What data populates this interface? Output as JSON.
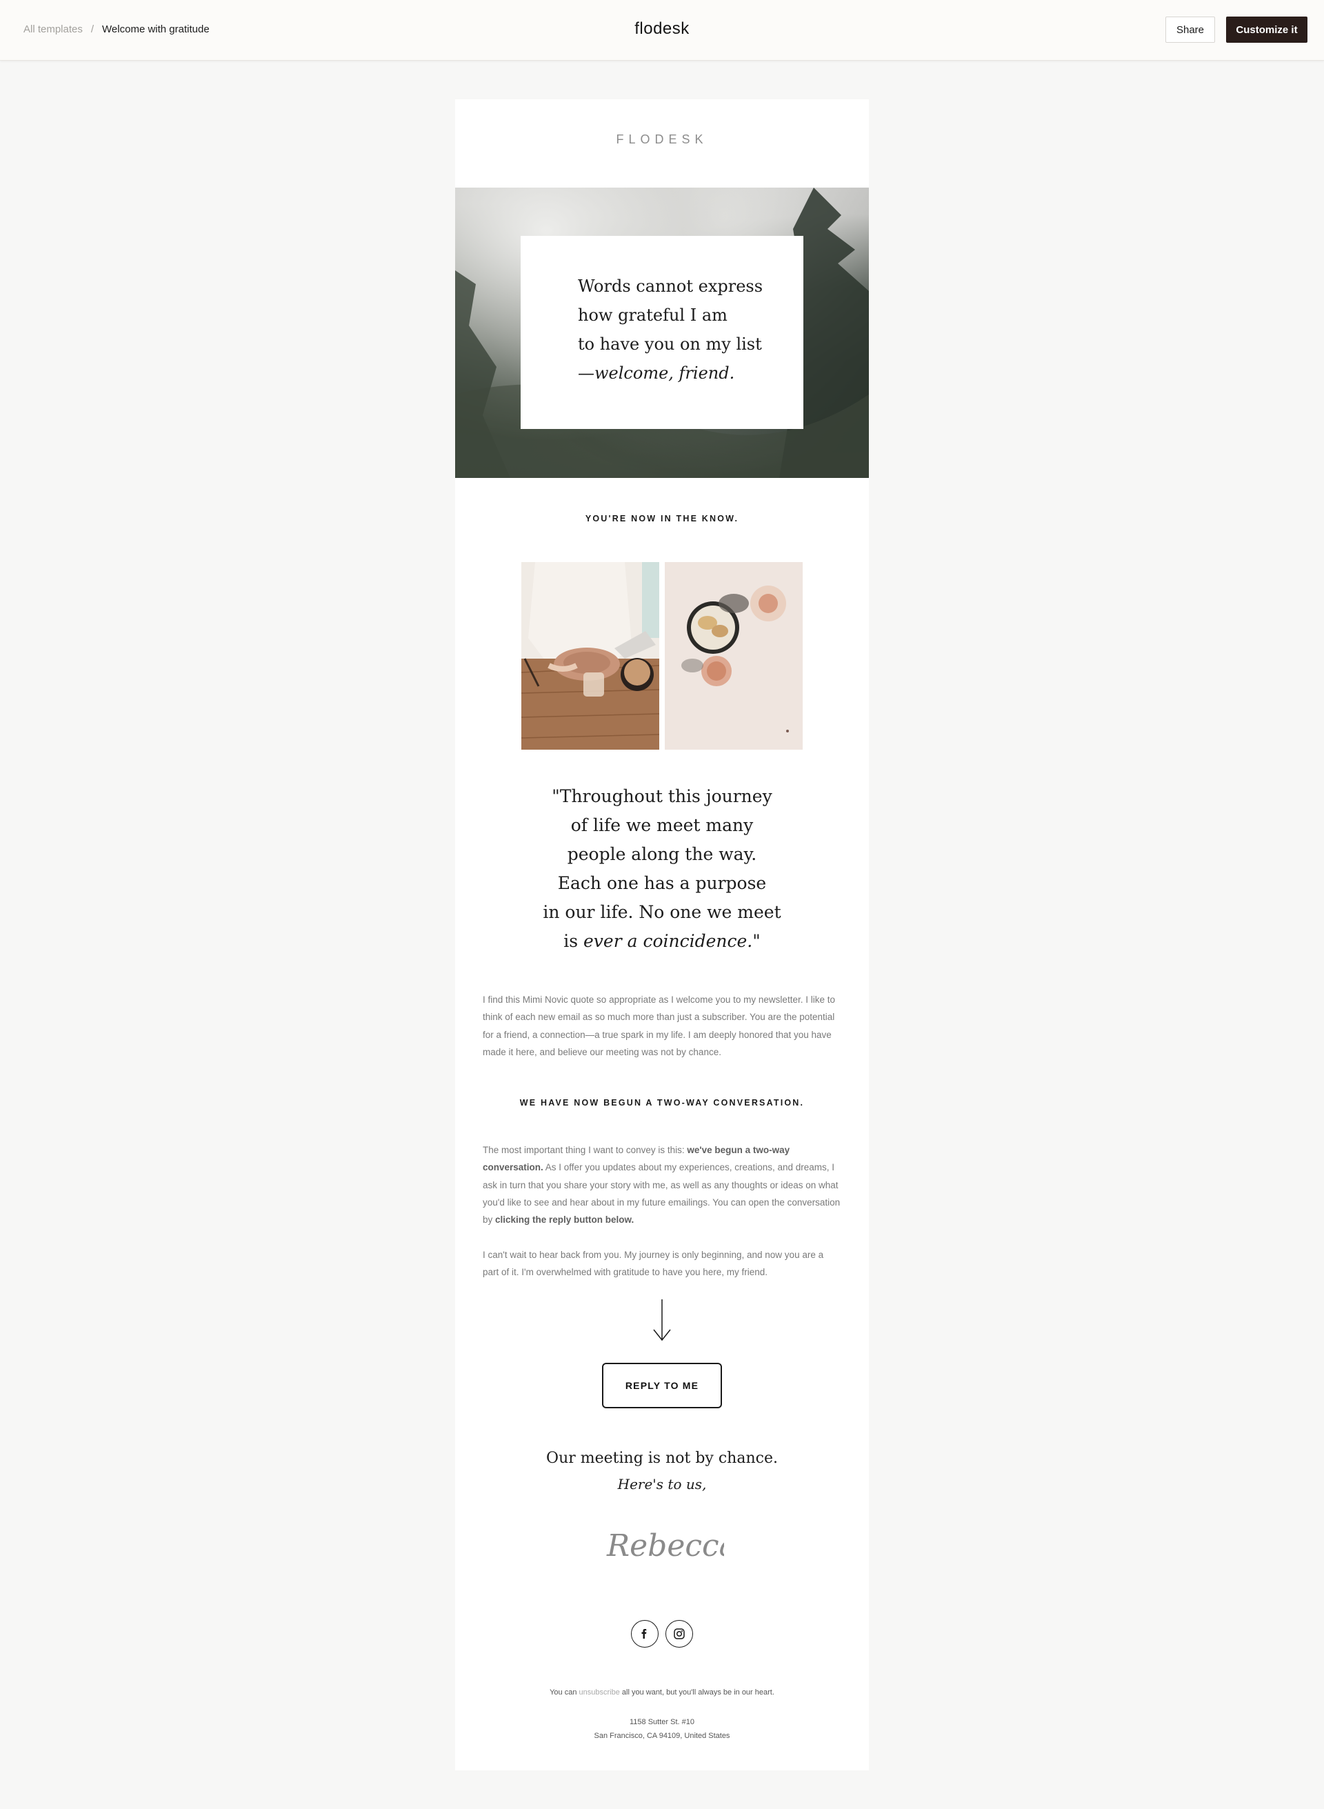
{
  "topbar": {
    "breadcrumb_root": "All templates",
    "breadcrumb_separator": "/",
    "breadcrumb_current": "Welcome with gratitude",
    "brand": "flodesk",
    "share_label": "Share",
    "customize_label": "Customize it"
  },
  "email": {
    "logo": "FLODESK",
    "hero": {
      "line1": "Words cannot express",
      "line2": "how grateful I am",
      "line3": "to have you on my list",
      "line4": "—welcome, friend."
    },
    "kicker1": "YOU'RE NOW IN THE KNOW.",
    "quote": {
      "line1": "\"Throughout this journey",
      "line2": "of life we meet many",
      "line3": "people along the way.",
      "line4": "Each one has a purpose",
      "line5": "in our life. No one we meet",
      "line6_plain": "is ",
      "line6_italic": "ever a coincidence.\""
    },
    "paragraph1": "I find this Mimi Novic quote so appropriate as I welcome you to my newsletter. I like to think of each new email as so much more than just a subscriber. You are the potential for a friend, a connection—a true spark in my life. I am deeply honored that you have made it here, and believe our meeting was not by chance.",
    "kicker2": "WE HAVE NOW BEGUN A TWO-WAY CONVERSATION.",
    "paragraph2": {
      "part1": "The most important thing I want to convey is this: ",
      "bold1": "we've begun a two-way conversation.",
      "part2": " As I offer you updates about my experiences, creations, and dreams, I ask in turn that you share your story with me, as well as any thoughts or ideas on what you'd like to see and hear about in my future emailings. You can open the conversation by ",
      "bold2": "clicking the reply button below."
    },
    "paragraph3": "I can't wait to hear back from you. My journey is only beginning, and now you are a part of it. I'm overwhelmed with gratitude to have you here, my friend.",
    "reply_label": "REPLY TO ME",
    "closing_line1": "Our meeting is not by chance.",
    "closing_line2": "Here's to us,",
    "signature": "Rebecca",
    "footer": {
      "part1": "You can ",
      "link": "unsubscribe",
      "part2": " all you want, but you'll always be in our heart."
    },
    "address_line1": "1158 Sutter St. #10",
    "address_line2": "San Francisco, CA 94109, United States"
  },
  "icons": [
    "facebook-icon",
    "instagram-icon",
    "arrow-down-icon"
  ],
  "colors": {
    "page_bg": "#f7f7f6",
    "primary_button": "#2a1d1a",
    "text_muted": "#7a7a7a"
  }
}
